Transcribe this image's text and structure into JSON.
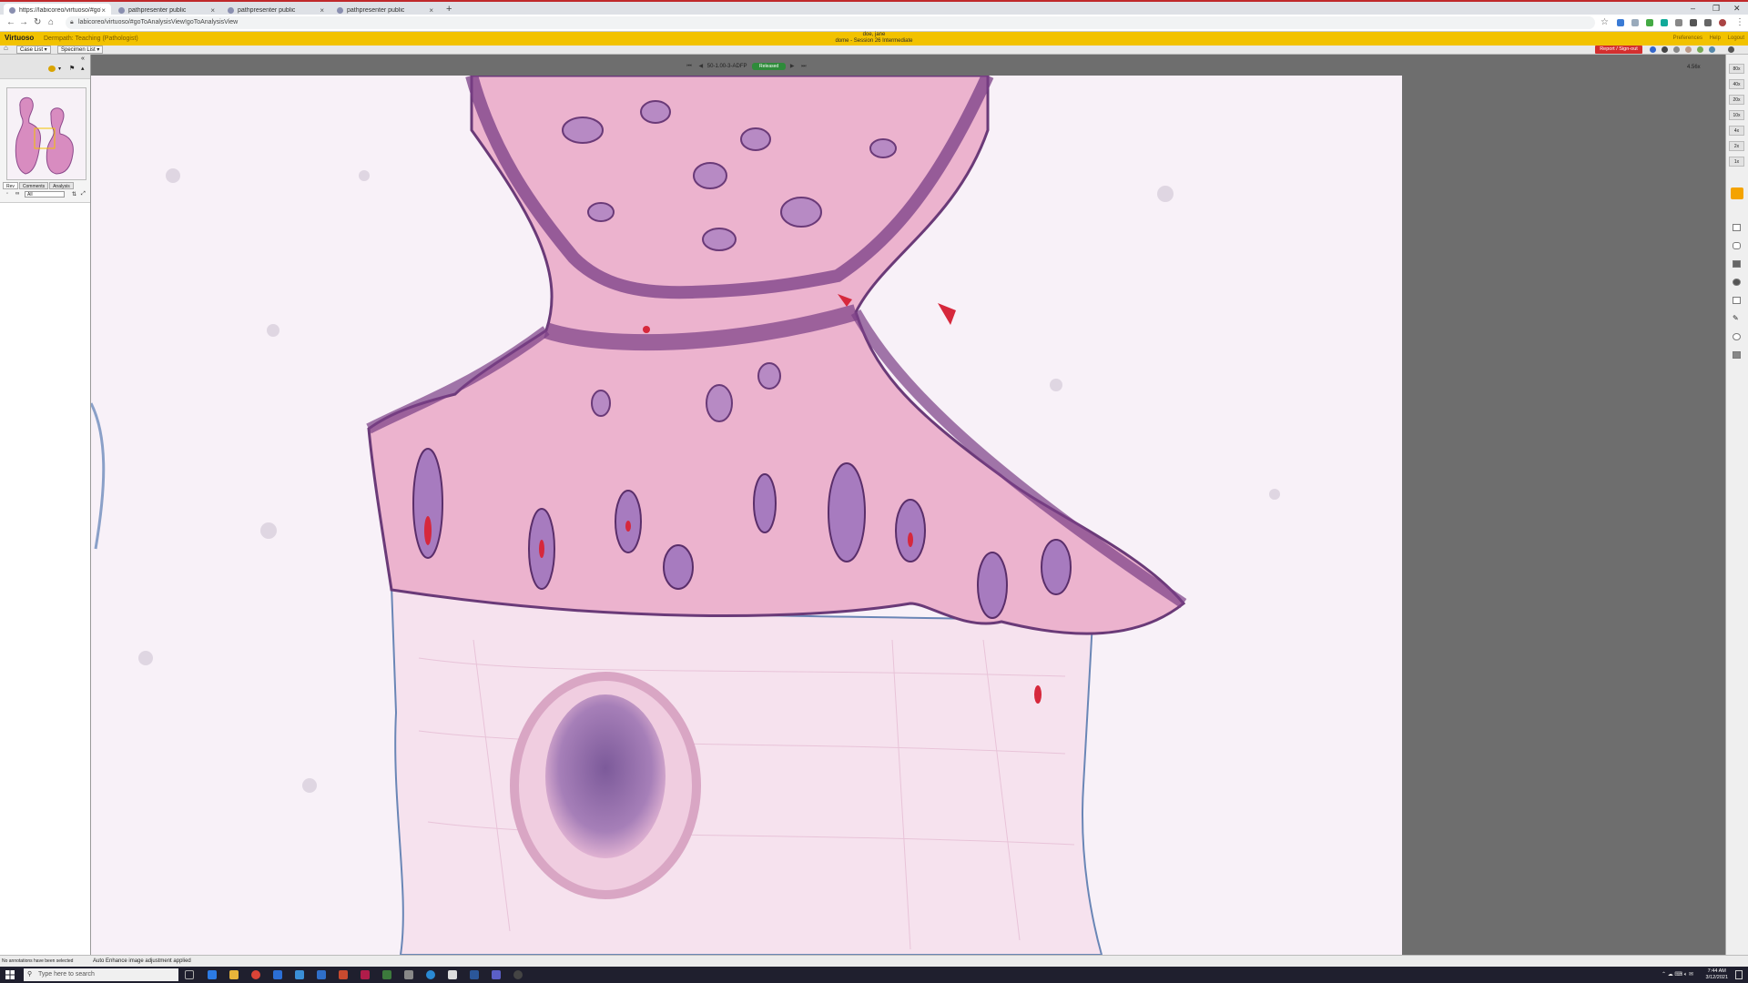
{
  "browser": {
    "tabs": [
      {
        "label": "https://labicoreo/virtuoso/#goTo",
        "active": true
      },
      {
        "label": "pathpresenter public",
        "active": false
      },
      {
        "label": "pathpresenter public",
        "active": false
      },
      {
        "label": "pathpresenter public",
        "active": false
      }
    ],
    "url": "labicoreo/virtuoso/#goToAnalysisView!goToAnalysisView",
    "new_tab_label": "+",
    "window_controls": [
      "–",
      "❐",
      "✕"
    ]
  },
  "app": {
    "brand": "Virtuoso",
    "subtitle": "Dermpath: Teaching (Pathologist)",
    "user_name": "doe, jane",
    "session": "dome - Session 26 Intermediate",
    "header_links": [
      "Preferences",
      "Help",
      "Logout"
    ],
    "accent_color": "#f2c200"
  },
  "toolbar": {
    "case_list": "Case List ▾",
    "specimen_list": "Specimen List ▾",
    "report_signout": "Report / Sign-out"
  },
  "left_panel": {
    "tabs": [
      "Rev",
      "Comments",
      "Analysis"
    ],
    "filter_value": "All"
  },
  "viewer": {
    "slide_id": "50-1.00-3-ADFP",
    "status": "Released",
    "zoom_readout": "4.56x",
    "status_color": "#2e8b3a"
  },
  "right_rail": {
    "zoom_levels": [
      "80x",
      "40x",
      "20x",
      "10x",
      "4x",
      "2x",
      "1x"
    ]
  },
  "status_bar": {
    "left": "No annotations have been selected",
    "message": "Auto Enhance image adjustment applied"
  },
  "taskbar": {
    "search_placeholder": "Type here to search",
    "time": "7:44 AM",
    "date": "3/12/2021"
  }
}
